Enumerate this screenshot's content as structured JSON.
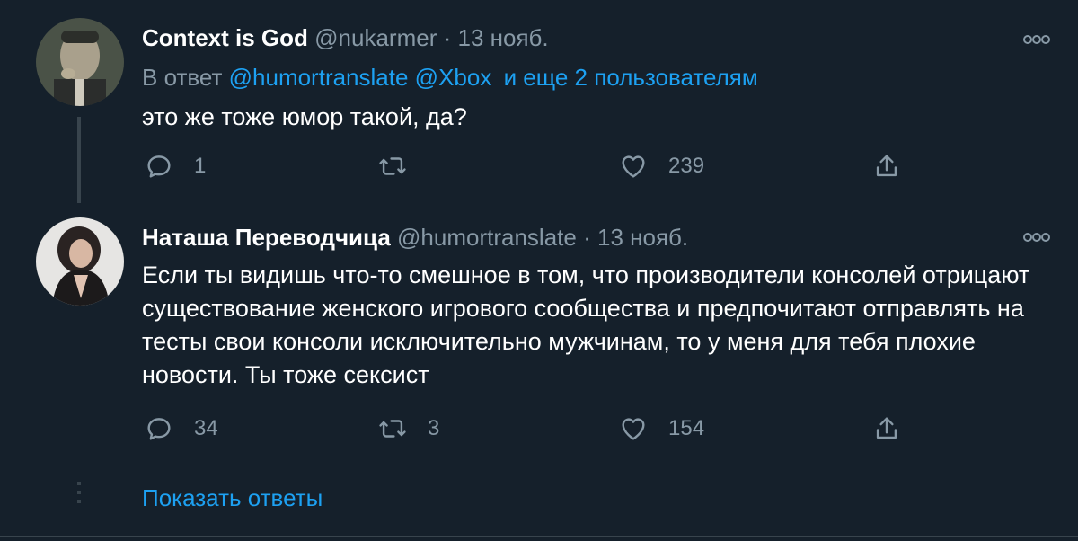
{
  "tweet1": {
    "name": "Context is God",
    "handle": "@nukarmer",
    "sep": "·",
    "date": "13 нояб.",
    "reply_prefix": "В ответ",
    "reply_mention1": "@humortranslate",
    "reply_mention2": "@Xbox",
    "reply_others": "и еще 2 пользователям",
    "text": "это же тоже юмор такой, да?",
    "actions": {
      "reply_count": "1",
      "retweet_count": "",
      "like_count": "239"
    }
  },
  "tweet2": {
    "name": "Наташа Переводчица",
    "handle": "@humortranslate",
    "sep": "·",
    "date": "13 нояб.",
    "text": "Если ты видишь что-то смешное в том, что производители консолей отрицают существование женского игрового сообщества и предпочитают отправлять на тесты свои консоли исключительно мужчинам, то у меня для тебя плохие новости. Ты тоже сексист",
    "actions": {
      "reply_count": "34",
      "retweet_count": "3",
      "like_count": "154"
    }
  },
  "show_replies": "Показать ответы",
  "colors": {
    "background": "#15202b",
    "link": "#1da1f2",
    "secondary_text": "#8899a6",
    "divider": "#38444d"
  },
  "icons": [
    "reply-icon",
    "retweet-icon",
    "like-icon",
    "share-icon",
    "more-icon"
  ]
}
